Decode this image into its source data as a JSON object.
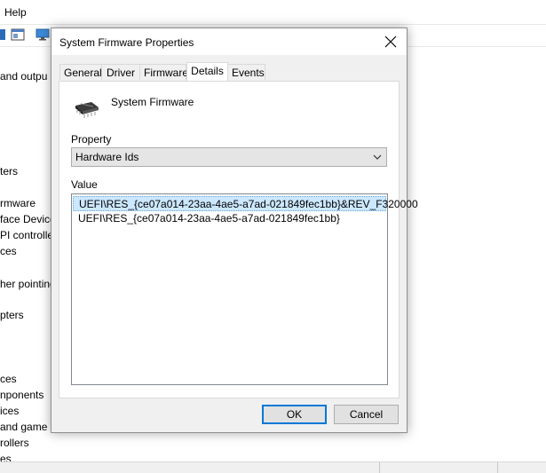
{
  "background": {
    "menu": {
      "help": "Help"
    },
    "tree_items": [
      "and outpu",
      "ters",
      "rmware",
      "face Device",
      "PI controlle",
      "ces",
      "her pointing",
      "pters",
      "ces",
      "nponents",
      "ices",
      "and game",
      "rollers",
      "es"
    ]
  },
  "dialog": {
    "title": "System Firmware Properties",
    "tabs": [
      {
        "label": "General"
      },
      {
        "label": "Driver"
      },
      {
        "label": "Firmware"
      },
      {
        "label": "Details",
        "active": true
      },
      {
        "label": "Events"
      }
    ],
    "device_name": "System Firmware",
    "property_label": "Property",
    "property_value": "Hardware Ids",
    "value_label": "Value",
    "values": [
      "UEFI\\RES_{ce07a014-23aa-4ae5-a7ad-021849fec1bb}&REV_F320000",
      "UEFI\\RES_{ce07a014-23aa-4ae5-a7ad-021849fec1bb}"
    ],
    "ok_label": "OK",
    "cancel_label": "Cancel"
  },
  "colors": {
    "accent": "#0078d7",
    "selection": "#cce8ff",
    "dialog_bg": "#f0f0f0"
  },
  "icons": {
    "device": "chip-icon",
    "close": "close-icon",
    "dropdown": "chevron-down-icon"
  }
}
